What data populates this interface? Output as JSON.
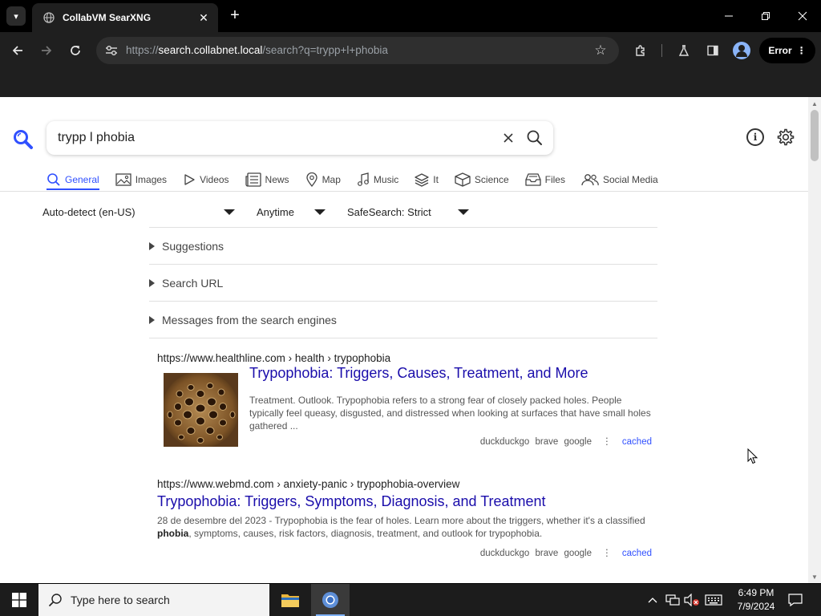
{
  "browser": {
    "tab_title": "CollabVM SearXNG",
    "url_prefix": "https://",
    "url_host": "search.collabnet.local",
    "url_path": "/search?q=trypp+l+phobia",
    "error_label": "Error"
  },
  "search": {
    "query": "trypp l phobia"
  },
  "categories": [
    {
      "label": "General",
      "icon": "search-icon",
      "active": true
    },
    {
      "label": "Images",
      "icon": "image-icon"
    },
    {
      "label": "Videos",
      "icon": "play-icon"
    },
    {
      "label": "News",
      "icon": "newspaper-icon"
    },
    {
      "label": "Map",
      "icon": "map-pin-icon"
    },
    {
      "label": "Music",
      "icon": "music-note-icon"
    },
    {
      "label": "It",
      "icon": "layers-icon"
    },
    {
      "label": "Science",
      "icon": "cube-icon"
    },
    {
      "label": "Files",
      "icon": "inbox-icon"
    },
    {
      "label": "Social Media",
      "icon": "people-icon"
    }
  ],
  "filters": {
    "language": "Auto-detect (en-US)",
    "time": "Anytime",
    "safesearch": "SafeSearch: Strict"
  },
  "panels": [
    "Suggestions",
    "Search URL",
    "Messages from the search engines"
  ],
  "results": [
    {
      "url": "https://www.healthline.com",
      "breadcrumb": "› health › trypophobia",
      "title": "Trypophobia: Triggers, Causes, Treatment, and More",
      "content": "Treatment. Outlook. Trypophobia refers to a strong fear of closely packed holes. People typically feel queasy, disgusted, and distressed when looking at surfaces that have small holes gathered ...",
      "engines": [
        "duckduckgo",
        "brave",
        "google"
      ],
      "cached": "cached"
    },
    {
      "url": "https://www.webmd.com",
      "breadcrumb": "› anxiety-panic › trypophobia-overview",
      "title": "Trypophobia: Triggers, Symptoms, Diagnosis, and Treatment",
      "content_pre": "28 de desembre del 2023 - Trypophobia is the fear of holes. Learn more about the triggers, whether it's a classified ",
      "content_bold": "phobia",
      "content_post": ", symptoms, causes, risk factors, diagnosis, treatment, and outlook for trypophobia.",
      "engines": [
        "duckduckgo",
        "brave",
        "google"
      ],
      "cached": "cached"
    }
  ],
  "taskbar": {
    "search_placeholder": "Type here to search",
    "time": "6:49 PM",
    "date": "7/9/2024"
  },
  "colors": {
    "accent": "#3050ff",
    "link": "#1a0dab",
    "chrome_bg": "#1f1f1f"
  }
}
